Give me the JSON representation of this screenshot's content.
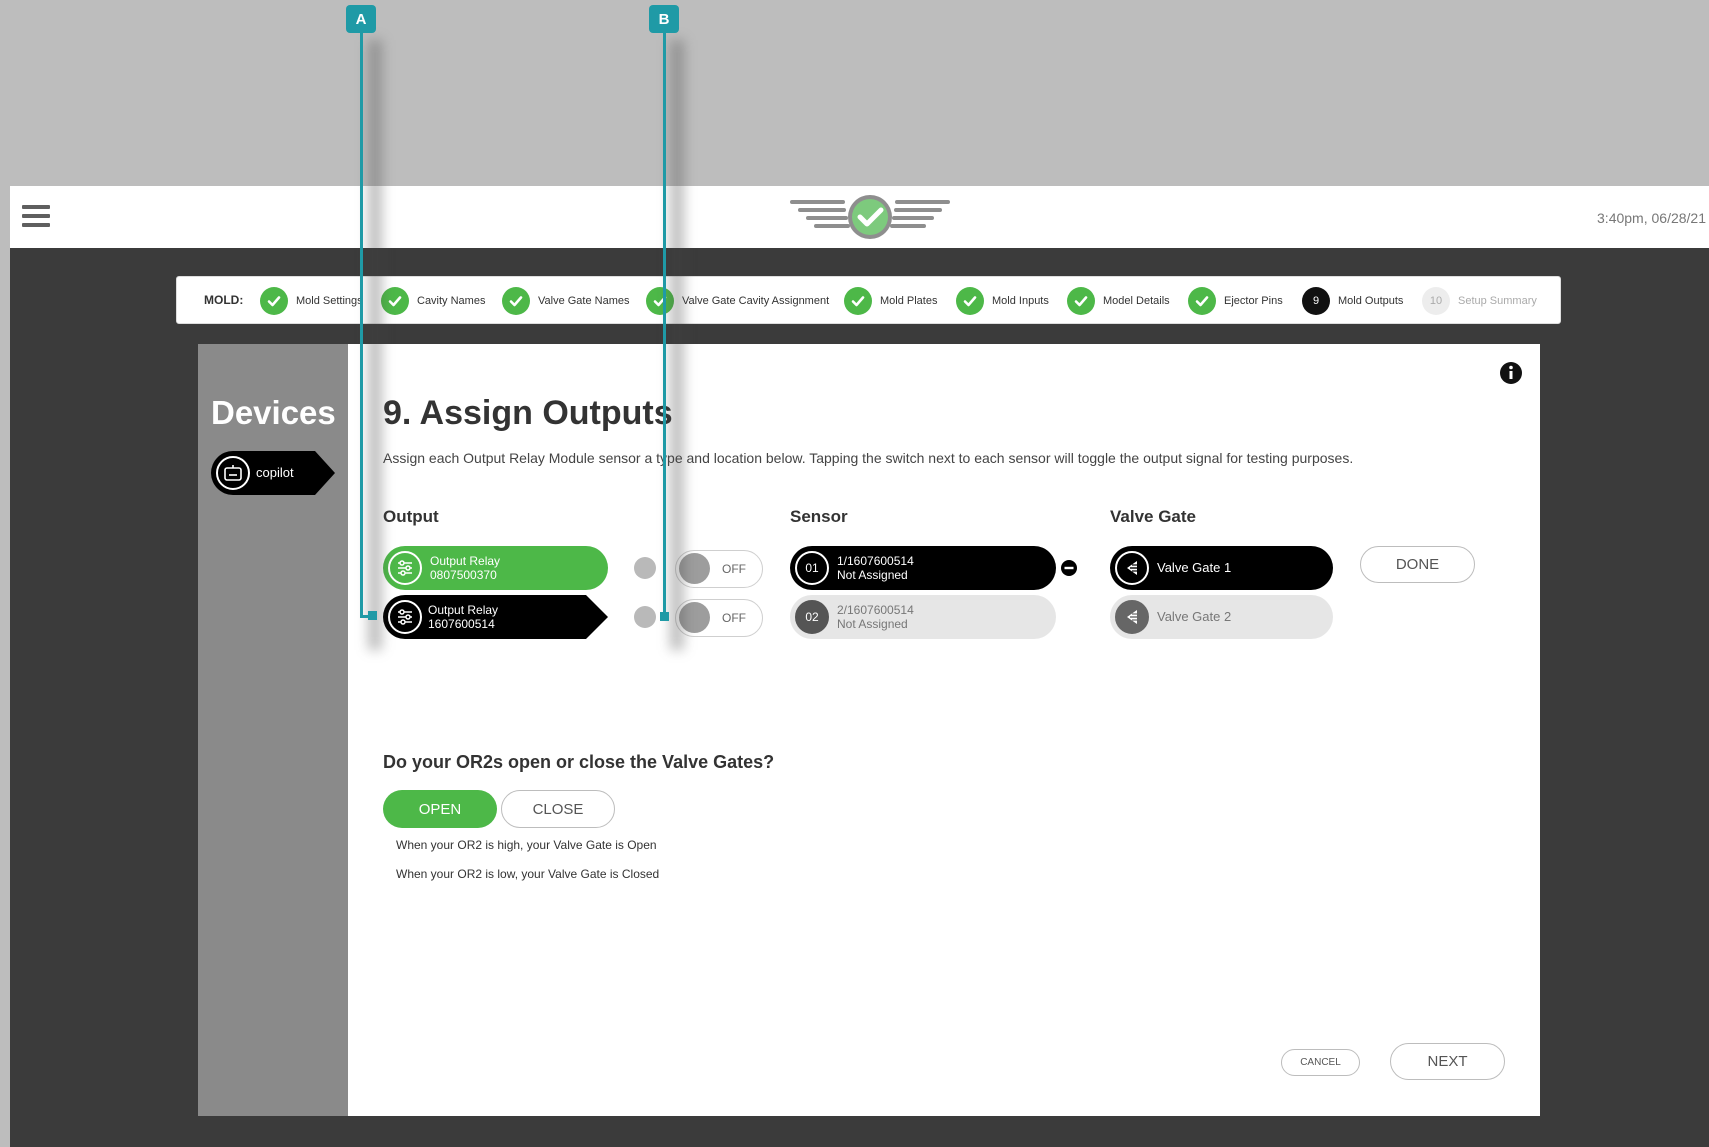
{
  "header": {
    "time": "3:40pm, 06/28/21",
    "logo_icon": "wings-check-logo",
    "menu_icon": "hamburger-icon"
  },
  "stepper": {
    "mold_label": "MOLD:",
    "steps": [
      {
        "label": "Mold Settings",
        "state": "done"
      },
      {
        "label": "Cavity Names",
        "state": "done"
      },
      {
        "label": "Valve Gate Names",
        "state": "done"
      },
      {
        "label": "Valve Gate Cavity Assignment",
        "state": "done"
      },
      {
        "label": "Mold Plates",
        "state": "done"
      },
      {
        "label": "Mold Inputs",
        "state": "done"
      },
      {
        "label": "Model Details",
        "state": "done"
      },
      {
        "label": "Ejector Pins",
        "state": "done"
      },
      {
        "label": "Mold Outputs",
        "number": "9",
        "state": "current"
      },
      {
        "label": "Setup Summary",
        "number": "10",
        "state": "pending"
      }
    ]
  },
  "sidebar": {
    "title": "Devices",
    "device": "copilot"
  },
  "main": {
    "title": "9. Assign Outputs",
    "instructions": "Assign each Output Relay Module sensor a type and location below. Tapping the switch next to each sensor will toggle the output signal for testing purposes.",
    "columns": {
      "output": "Output",
      "sensor": "Sensor",
      "valve_gate": "Valve Gate"
    },
    "outputs": [
      {
        "line1": "Output Relay",
        "line2": "0807500370",
        "toggle": "OFF"
      },
      {
        "line1": "Output Relay",
        "line2": "1607600514",
        "toggle": "OFF"
      }
    ],
    "sensors": [
      {
        "num": "01",
        "line1": "1/1607600514",
        "line2": "Not Assigned"
      },
      {
        "num": "02",
        "line1": "2/1607600514",
        "line2": "Not Assigned"
      }
    ],
    "valve_gates": [
      {
        "label": "Valve Gate 1"
      },
      {
        "label": "Valve Gate 2"
      }
    ],
    "done_label": "DONE",
    "question": "Do your OR2s open or close the Valve Gates?",
    "open_label": "OPEN",
    "close_label": "CLOSE",
    "note_high": "When your OR2 is high, your Valve Gate is Open",
    "note_low": "When your OR2 is low, your Valve Gate is Closed",
    "cancel_label": "CANCEL",
    "next_label": "NEXT"
  },
  "callouts": {
    "a": "A",
    "b": "B"
  },
  "colors": {
    "accent_green": "#4db848",
    "callout_teal": "#1f9aa6",
    "dark": "#000000"
  }
}
